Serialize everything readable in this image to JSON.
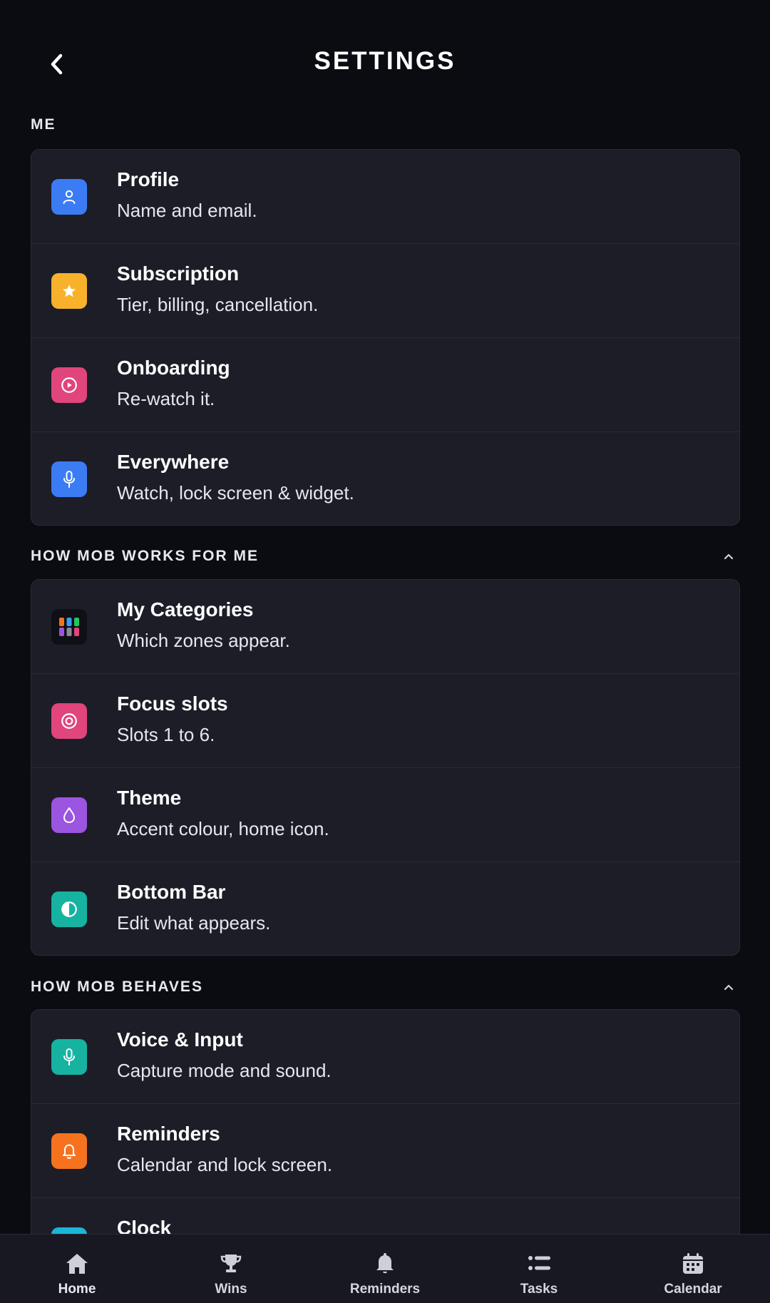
{
  "header": {
    "title": "SETTINGS"
  },
  "sections": [
    {
      "title": "ME",
      "items": [
        {
          "title": "Profile",
          "subtitle": "Name and email.",
          "icon": "person-icon",
          "color": "#3b7cf4"
        },
        {
          "title": "Subscription",
          "subtitle": "Tier, billing, cancellation.",
          "icon": "star-icon",
          "color": "#f7b12a"
        },
        {
          "title": "Onboarding",
          "subtitle": "Re-watch it.",
          "icon": "play-circle-icon",
          "color": "#e0457b"
        },
        {
          "title": "Everywhere",
          "subtitle": "Watch, lock screen & widget.",
          "icon": "microphone-icon",
          "color": "#3b7cf4"
        }
      ]
    },
    {
      "title": "HOW MOB WORKS FOR ME",
      "items": [
        {
          "title": "My Categories",
          "subtitle": "Which zones appear.",
          "icon": "category-grid-icon",
          "color": "#0f0f16"
        },
        {
          "title": "Focus slots",
          "subtitle": "Slots 1 to 6.",
          "icon": "target-icon",
          "color": "#e0457b"
        },
        {
          "title": "Theme",
          "subtitle": "Accent colour, home icon.",
          "icon": "droplet-icon",
          "color": "#9b55e0"
        },
        {
          "title": "Bottom Bar",
          "subtitle": "Edit what appears.",
          "icon": "half-circle-icon",
          "color": "#16b3a0"
        }
      ]
    },
    {
      "title": "HOW MOB BEHAVES",
      "items": [
        {
          "title": "Voice & Input",
          "subtitle": "Capture mode and sound.",
          "icon": "microphone-icon",
          "color": "#16b3a0"
        },
        {
          "title": "Reminders",
          "subtitle": "Calendar and lock screen.",
          "icon": "bell-icon",
          "color": "#f7721e"
        },
        {
          "title": "Clock",
          "subtitle": "",
          "icon": "clock-icon",
          "color": "#1bb6d6"
        }
      ]
    }
  ],
  "nav": [
    {
      "label": "Home",
      "icon": "home-icon"
    },
    {
      "label": "Wins",
      "icon": "trophy-icon"
    },
    {
      "label": "Reminders",
      "icon": "bell-icon"
    },
    {
      "label": "Tasks",
      "icon": "list-icon"
    },
    {
      "label": "Calendar",
      "icon": "calendar-icon"
    }
  ],
  "colors": {
    "background": "#0b0c12",
    "card": "#1d1d28",
    "nav": "#181822"
  }
}
